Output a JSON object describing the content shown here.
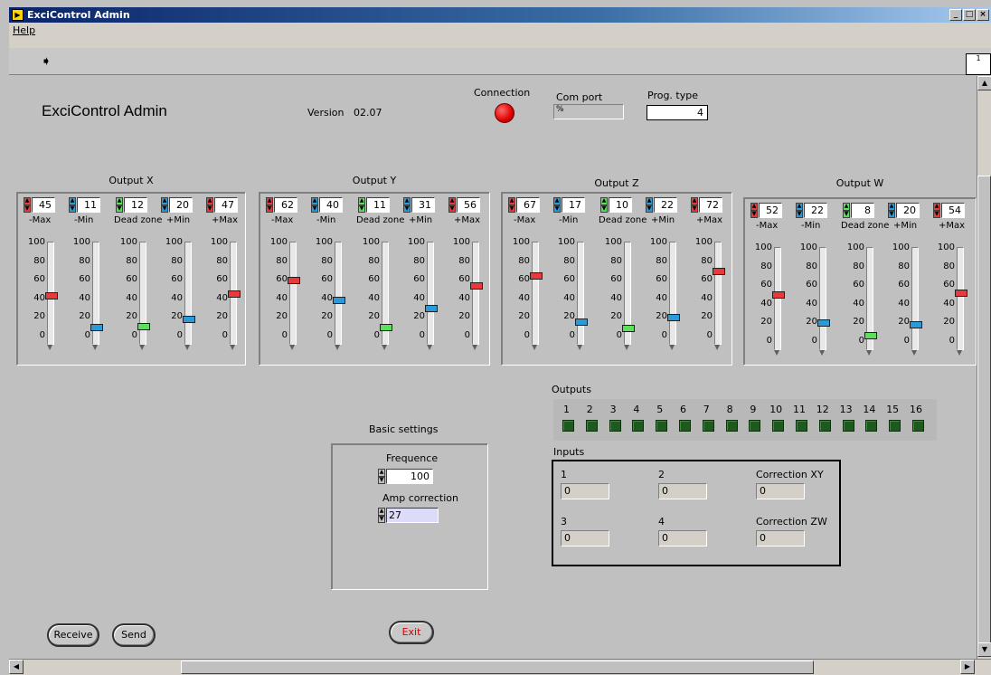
{
  "window": {
    "title": "ExciControl Admin",
    "min": "_",
    "max": "□",
    "close": "×"
  },
  "menu": {
    "help": "Help"
  },
  "toolbar": {
    "run_icon": "run-arrow-icon",
    "vi_icon": "vi-icon",
    "vi_label": "1"
  },
  "header": {
    "app_title": "ExciControl Admin",
    "version_label": "Version",
    "version_value": "02.07",
    "connection_label": "Connection",
    "connection_status_color": "#e00000",
    "com_port_label": "Com port",
    "com_port_value": "%",
    "prog_type_label": "Prog. type",
    "prog_type_value": "4"
  },
  "outputs_panels": [
    {
      "title": "Output X",
      "labels": [
        "-Max",
        "-Min",
        "Dead zone",
        "+Min",
        "+Max"
      ],
      "values": [
        "45",
        "11",
        "12",
        "20",
        "47"
      ]
    },
    {
      "title": "Output Y",
      "labels": [
        "-Max",
        "-Min",
        "Dead zone",
        "+Min",
        "+Max"
      ],
      "values": [
        "62",
        "40",
        "11",
        "31",
        "56"
      ]
    },
    {
      "title": "Output Z",
      "labels": [
        "-Max",
        "-Min",
        "Dead zone",
        "+Min",
        "+Max"
      ],
      "values": [
        "67",
        "17",
        "10",
        "22",
        "72"
      ]
    },
    {
      "title": "Output W",
      "labels": [
        "-Max",
        "-Min",
        "Dead zone",
        "+Min",
        "+Max"
      ],
      "values": [
        "52",
        "22",
        "8",
        "20",
        "54"
      ]
    }
  ],
  "slider_ticks": [
    "100",
    "80",
    "60",
    "40",
    "20",
    "0"
  ],
  "control_colors": [
    "#e83a3a",
    "#2a9ad8",
    "#5ce05c",
    "#2a9ad8",
    "#e83a3a"
  ],
  "outputs": {
    "label": "Outputs",
    "numbers": [
      "1",
      "2",
      "3",
      "4",
      "5",
      "6",
      "7",
      "8",
      "9",
      "10",
      "11",
      "12",
      "13",
      "14",
      "15",
      "16"
    ]
  },
  "inputs": {
    "label": "Inputs",
    "fields": [
      {
        "label": "1",
        "value": "0"
      },
      {
        "label": "2",
        "value": "0"
      },
      {
        "label": "Correction XY",
        "value": "0"
      },
      {
        "label": "3",
        "value": "0"
      },
      {
        "label": "4",
        "value": "0"
      },
      {
        "label": "Correction ZW",
        "value": "0"
      }
    ]
  },
  "basic_settings": {
    "title": "Basic settings",
    "frequence_label": "Frequence",
    "frequence_value": "100",
    "amp_label": "Amp correction",
    "amp_value": "27"
  },
  "buttons": {
    "receive": "Receive",
    "send": "Send",
    "exit": "Exit"
  }
}
